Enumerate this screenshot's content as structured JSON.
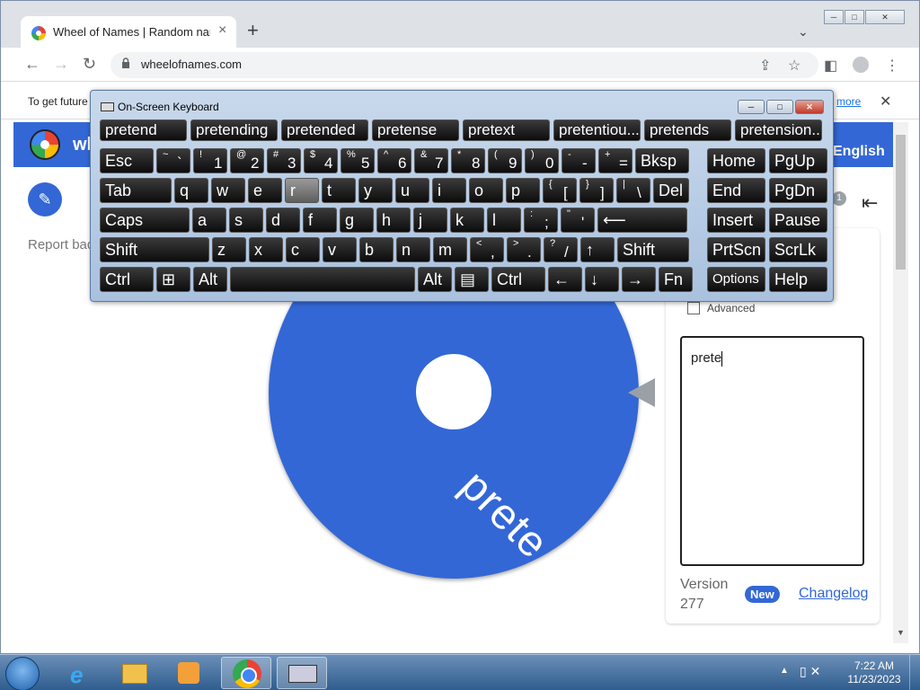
{
  "browser": {
    "tab_title": "Wheel of Names | Random name picker",
    "tab_close": "×",
    "new_tab": "+",
    "url": "wheelofnames.com",
    "window_buttons": {
      "minimize": "▭",
      "maximize": "▭",
      "close": "✕"
    }
  },
  "infobar": {
    "text": "To get future Google Chrome updates...",
    "link": "more",
    "close": "✕"
  },
  "page": {
    "app_name": "wheelofnames",
    "language": "English",
    "report": "Report bad content",
    "wheel_label": "prete",
    "advanced": "Advanced",
    "names_text": "prete",
    "version_label": "Version",
    "version_number": "277",
    "new_badge": "New",
    "changelog": "Changelog",
    "counter": "1"
  },
  "osk": {
    "title": "On-Screen Keyboard",
    "predictions": [
      "pretend",
      "pretending",
      "pretended",
      "pretense",
      "pretext",
      "pretentiou...",
      "pretends",
      "pretension..."
    ],
    "rows": [
      [
        {
          "t": "Esc",
          "w": 60
        },
        {
          "s": "~",
          "b": "`",
          "w": 38
        },
        {
          "s": "!",
          "b": "1",
          "w": 38
        },
        {
          "s": "@",
          "b": "2",
          "w": 38
        },
        {
          "s": "#",
          "b": "3",
          "w": 38
        },
        {
          "s": "$",
          "b": "4",
          "w": 38
        },
        {
          "s": "%",
          "b": "5",
          "w": 38
        },
        {
          "s": "^",
          "b": "6",
          "w": 38
        },
        {
          "s": "&",
          "b": "7",
          "w": 38
        },
        {
          "s": "*",
          "b": "8",
          "w": 38
        },
        {
          "s": "(",
          "b": "9",
          "w": 38
        },
        {
          "s": ")",
          "b": "0",
          "w": 38
        },
        {
          "s": "-",
          "b": "-",
          "w": 38
        },
        {
          "s": "+",
          "b": "=",
          "w": 38
        },
        {
          "t": "Bksp",
          "w": 60
        }
      ],
      [
        {
          "t": "Tab",
          "w": 80
        },
        {
          "t": "q",
          "w": 38
        },
        {
          "t": "w",
          "w": 38
        },
        {
          "t": "e",
          "w": 38
        },
        {
          "t": "r",
          "w": 38,
          "hl": true
        },
        {
          "t": "t",
          "w": 38
        },
        {
          "t": "y",
          "w": 38
        },
        {
          "t": "u",
          "w": 38
        },
        {
          "t": "i",
          "w": 38
        },
        {
          "t": "o",
          "w": 38
        },
        {
          "t": "p",
          "w": 38
        },
        {
          "s": "{",
          "b": "[",
          "w": 38
        },
        {
          "s": "}",
          "b": "]",
          "w": 38
        },
        {
          "s": "|",
          "b": "\\",
          "w": 38
        },
        {
          "t": "Del",
          "w": 40
        }
      ],
      [
        {
          "t": "Caps",
          "w": 100
        },
        {
          "t": "a",
          "w": 38
        },
        {
          "t": "s",
          "w": 38
        },
        {
          "t": "d",
          "w": 38
        },
        {
          "t": "f",
          "w": 38
        },
        {
          "t": "g",
          "w": 38
        },
        {
          "t": "h",
          "w": 38
        },
        {
          "t": "j",
          "w": 38
        },
        {
          "t": "k",
          "w": 38
        },
        {
          "t": "l",
          "w": 38
        },
        {
          "s": ":",
          "b": ";",
          "w": 38
        },
        {
          "s": "\"",
          "b": "'",
          "w": 38
        },
        {
          "t": "⟵",
          "w": 100
        }
      ],
      [
        {
          "t": "Shift",
          "w": 122
        },
        {
          "t": "z",
          "w": 38
        },
        {
          "t": "x",
          "w": 38
        },
        {
          "t": "c",
          "w": 38
        },
        {
          "t": "v",
          "w": 38
        },
        {
          "t": "b",
          "w": 38
        },
        {
          "t": "n",
          "w": 38
        },
        {
          "t": "m",
          "w": 38
        },
        {
          "s": "<",
          "b": ",",
          "w": 38
        },
        {
          "s": ">",
          "b": ".",
          "w": 38
        },
        {
          "s": "?",
          "b": "/",
          "w": 38
        },
        {
          "t": "↑",
          "w": 38
        },
        {
          "t": "Shift",
          "w": 80
        }
      ],
      [
        {
          "t": "Ctrl",
          "w": 60
        },
        {
          "t": "⊞",
          "w": 38
        },
        {
          "t": "Alt",
          "w": 38
        },
        {
          "t": "",
          "w": 206
        },
        {
          "t": "Alt",
          "w": 38
        },
        {
          "t": "▤",
          "w": 38
        },
        {
          "t": "Ctrl",
          "w": 60
        },
        {
          "t": "←",
          "w": 38
        },
        {
          "t": "↓",
          "w": 38
        },
        {
          "t": "→",
          "w": 38
        },
        {
          "t": "Fn",
          "w": 38
        }
      ]
    ],
    "side_keys": [
      [
        "Home",
        "PgUp"
      ],
      [
        "End",
        "PgDn"
      ],
      [
        "Insert",
        "Pause"
      ],
      [
        "PrtScn",
        "ScrLk"
      ],
      [
        "Options",
        "Help"
      ]
    ]
  },
  "taskbar": {
    "time": "7:22 AM",
    "date": "11/23/2023"
  }
}
